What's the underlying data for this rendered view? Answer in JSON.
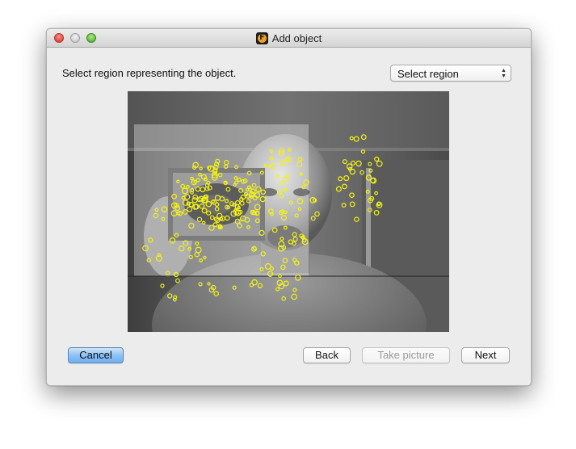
{
  "window": {
    "title": "Add object",
    "app_icon_letter": "F"
  },
  "instruction": "Select region representing the object.",
  "mode_select": {
    "selected": "Select region"
  },
  "buttons": {
    "cancel": "Cancel",
    "back": "Back",
    "take_picture": "Take picture",
    "next": "Next"
  },
  "colors": {
    "keypoint": "#f2f218",
    "default_button": "#8ec2f5"
  }
}
